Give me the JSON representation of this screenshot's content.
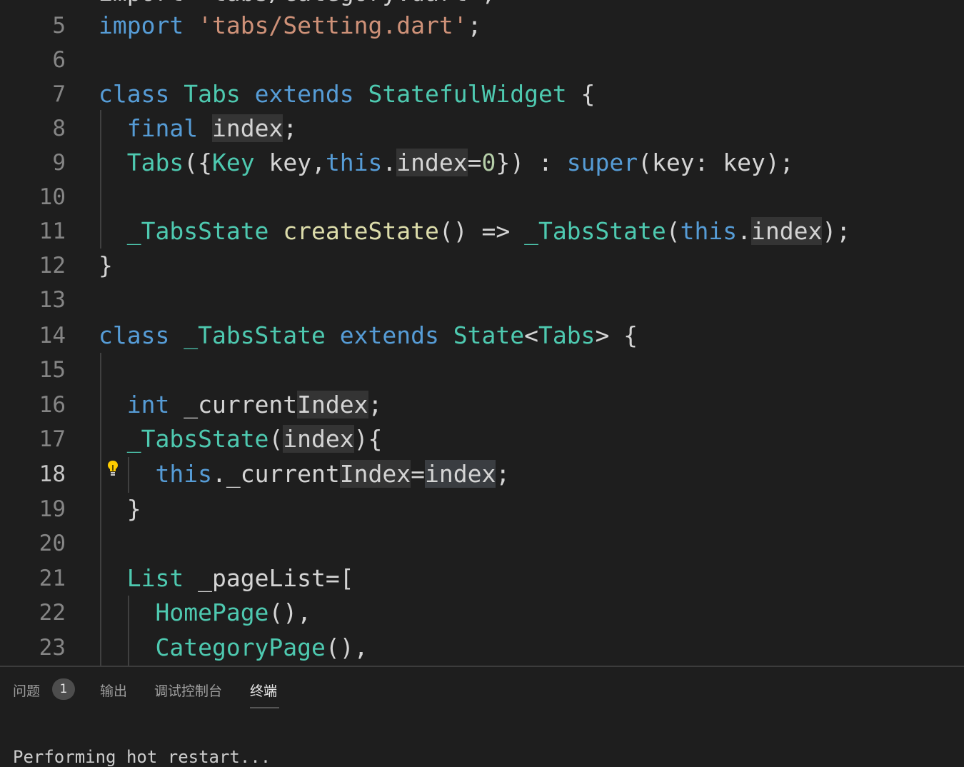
{
  "editor": {
    "line_numbers": [
      "5",
      "6",
      "7",
      "8",
      "9",
      "10",
      "11",
      "12",
      "13",
      "14",
      "15",
      "16",
      "17",
      "18",
      "19",
      "20",
      "21",
      "22",
      "23"
    ],
    "active_line": "18",
    "top_partial_text": "import 'tabs/Category.dart';",
    "lines": {
      "l5": [
        "import",
        " ",
        "'tabs/Setting.dart'",
        ";"
      ],
      "l7": [
        "class",
        " ",
        "Tabs",
        " ",
        "extends",
        " ",
        "StatefulWidget",
        " {"
      ],
      "l8": [
        "  ",
        "final",
        " ",
        "index",
        ";"
      ],
      "l9": [
        "  ",
        "Tabs",
        "({",
        "Key",
        " key,",
        "this",
        ".",
        "index",
        "=",
        "0",
        "}) : ",
        "super",
        "(key: key);"
      ],
      "l11": [
        "  ",
        "_TabsState",
        " ",
        "createState",
        "() => ",
        "_TabsState",
        "(",
        "this",
        ".",
        "index",
        ");"
      ],
      "l12": [
        "}"
      ],
      "l14": [
        "class",
        " ",
        "_TabsState",
        " ",
        "extends",
        " ",
        "State",
        "<",
        "Tabs",
        "> {"
      ],
      "l16": [
        "  ",
        "int",
        " _current",
        "Index",
        ";"
      ],
      "l17": [
        "  ",
        "_TabsState",
        "(",
        "index",
        "){"
      ],
      "l18": [
        "    ",
        "this",
        "._current",
        "Index",
        "=",
        "index",
        ";"
      ],
      "l19": [
        "  }"
      ],
      "l21": [
        "  ",
        "List",
        " _pageList=["
      ],
      "l22": [
        "    ",
        "HomePage",
        "(),"
      ],
      "l23": [
        "    ",
        "CategoryPage",
        "(),"
      ]
    }
  },
  "panel": {
    "tabs": [
      {
        "label": "问题",
        "active": false
      },
      {
        "label": "输出",
        "active": false
      },
      {
        "label": "调试控制台",
        "active": false
      },
      {
        "label": "终端",
        "active": true
      }
    ],
    "problems_count": "1",
    "bottom_partial_text": "Performing hot restart..."
  },
  "icons": {
    "lightbulb": "lightbulb-icon"
  },
  "colors": {
    "background": "#1e1e1e",
    "keyword": "#569cd6",
    "type": "#4ec9b0",
    "string": "#ce9178",
    "function": "#dcdcaa",
    "lightbulb": "#ffcc00"
  }
}
